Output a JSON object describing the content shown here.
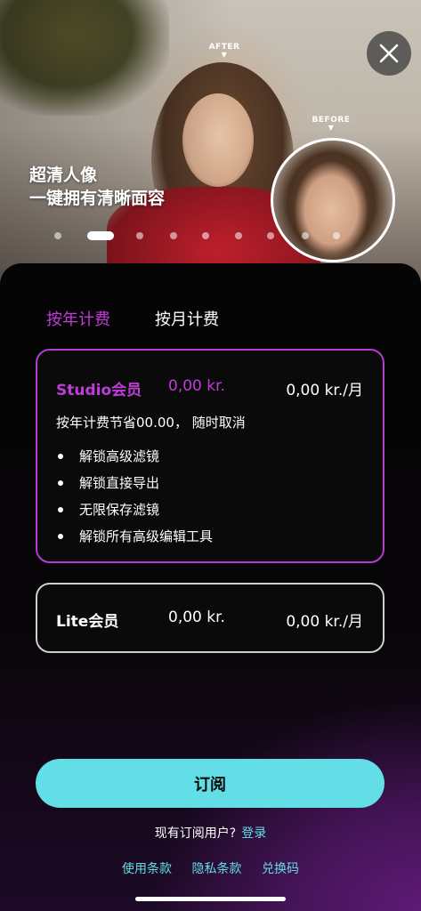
{
  "hero": {
    "after_label": "AFTER",
    "before_label": "BEFORE",
    "headline_line1": "超清人像",
    "headline_line2": "一键拥有清晰面容",
    "carousel_count": 9,
    "carousel_active": 1
  },
  "tabs": {
    "yearly": "按年计费",
    "monthly": "按月计费",
    "active": "yearly"
  },
  "plans": {
    "studio": {
      "name": "Studio会员",
      "price": "0,00 kr.",
      "monthly": "0,00 kr./月",
      "note": "按年计费节省00.00， 随时取消",
      "features": [
        "解锁高级滤镜",
        "解锁直接导出",
        "无限保存滤镜",
        "解锁所有高级编辑工具"
      ]
    },
    "lite": {
      "name": "Lite会员",
      "price": "0,00 kr.",
      "monthly": "0,00 kr./月"
    }
  },
  "actions": {
    "subscribe": "订阅",
    "existing_user": "现有订阅用户?",
    "login": "登录",
    "terms": "使用条款",
    "privacy": "隐私条款",
    "redeem": "兑换码"
  },
  "colors": {
    "accent_purple": "#c13bd9",
    "accent_cyan": "#63dde6"
  }
}
